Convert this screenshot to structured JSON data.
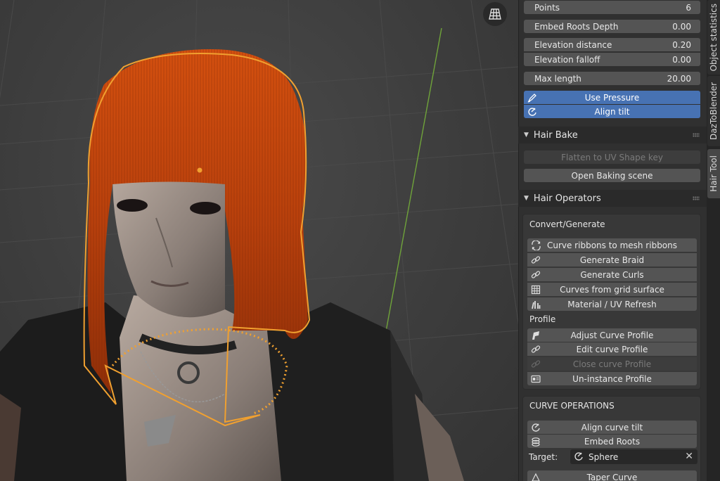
{
  "viewport": {
    "gizmo_icon": "grid-view-icon"
  },
  "tool_settings": {
    "points_label": "Points",
    "points_value": "6",
    "embed_roots_label": "Embed Roots Depth",
    "embed_roots_value": "0.00",
    "elev_dist_label": "Elevation distance",
    "elev_dist_value": "0.20",
    "elev_falloff_label": "Elevation falloff",
    "elev_falloff_value": "0.00",
    "max_length_label": "Max length",
    "max_length_value": "20.00",
    "use_pressure": "Use Pressure",
    "align_tilt": "Align tilt"
  },
  "hair_bake": {
    "title": "Hair Bake",
    "flatten": "Flatten to UV Shape key",
    "open_baking": "Open Baking scene"
  },
  "hair_operators": {
    "title": "Hair Operators",
    "convert_label": "Convert/Generate",
    "buttons": [
      "Curve ribbons to mesh ribbons",
      "Generate Braid",
      "Generate Curls",
      "Curves from grid surface",
      "Material / UV Refresh"
    ],
    "profile_label": "Profile",
    "profile_buttons": [
      "Adjust Curve Profile",
      "Edit curve Profile",
      "Close curve Profile",
      "Un-instance Profile"
    ]
  },
  "curve_ops": {
    "title": "CURVE OPERATIONS",
    "align_curve_tilt": "Align curve tilt",
    "embed_roots": "Embed Roots",
    "target_label": "Target:",
    "target_value": "Sphere",
    "taper_curve": "Taper Curve"
  },
  "tabs": [
    "Object statistics",
    "DazToBlender",
    "Hair Tool"
  ],
  "colors": {
    "accent_blue": "#4772b3",
    "selection_orange": "#f0a030",
    "hair": "#c2420c"
  }
}
